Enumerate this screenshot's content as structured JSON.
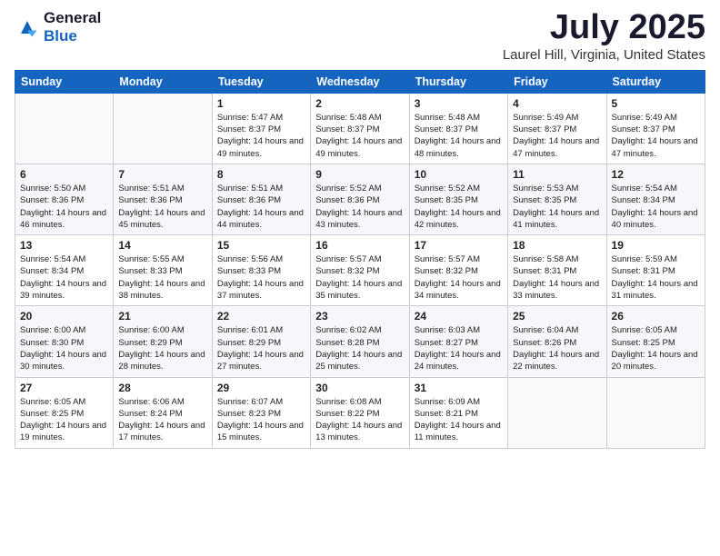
{
  "header": {
    "logo_general": "General",
    "logo_blue": "Blue",
    "month": "July 2025",
    "location": "Laurel Hill, Virginia, United States"
  },
  "days_of_week": [
    "Sunday",
    "Monday",
    "Tuesday",
    "Wednesday",
    "Thursday",
    "Friday",
    "Saturday"
  ],
  "weeks": [
    [
      {
        "day": "",
        "sunrise": "",
        "sunset": "",
        "daylight": ""
      },
      {
        "day": "",
        "sunrise": "",
        "sunset": "",
        "daylight": ""
      },
      {
        "day": "1",
        "sunrise": "Sunrise: 5:47 AM",
        "sunset": "Sunset: 8:37 PM",
        "daylight": "Daylight: 14 hours and 49 minutes."
      },
      {
        "day": "2",
        "sunrise": "Sunrise: 5:48 AM",
        "sunset": "Sunset: 8:37 PM",
        "daylight": "Daylight: 14 hours and 49 minutes."
      },
      {
        "day": "3",
        "sunrise": "Sunrise: 5:48 AM",
        "sunset": "Sunset: 8:37 PM",
        "daylight": "Daylight: 14 hours and 48 minutes."
      },
      {
        "day": "4",
        "sunrise": "Sunrise: 5:49 AM",
        "sunset": "Sunset: 8:37 PM",
        "daylight": "Daylight: 14 hours and 47 minutes."
      },
      {
        "day": "5",
        "sunrise": "Sunrise: 5:49 AM",
        "sunset": "Sunset: 8:37 PM",
        "daylight": "Daylight: 14 hours and 47 minutes."
      }
    ],
    [
      {
        "day": "6",
        "sunrise": "Sunrise: 5:50 AM",
        "sunset": "Sunset: 8:36 PM",
        "daylight": "Daylight: 14 hours and 46 minutes."
      },
      {
        "day": "7",
        "sunrise": "Sunrise: 5:51 AM",
        "sunset": "Sunset: 8:36 PM",
        "daylight": "Daylight: 14 hours and 45 minutes."
      },
      {
        "day": "8",
        "sunrise": "Sunrise: 5:51 AM",
        "sunset": "Sunset: 8:36 PM",
        "daylight": "Daylight: 14 hours and 44 minutes."
      },
      {
        "day": "9",
        "sunrise": "Sunrise: 5:52 AM",
        "sunset": "Sunset: 8:36 PM",
        "daylight": "Daylight: 14 hours and 43 minutes."
      },
      {
        "day": "10",
        "sunrise": "Sunrise: 5:52 AM",
        "sunset": "Sunset: 8:35 PM",
        "daylight": "Daylight: 14 hours and 42 minutes."
      },
      {
        "day": "11",
        "sunrise": "Sunrise: 5:53 AM",
        "sunset": "Sunset: 8:35 PM",
        "daylight": "Daylight: 14 hours and 41 minutes."
      },
      {
        "day": "12",
        "sunrise": "Sunrise: 5:54 AM",
        "sunset": "Sunset: 8:34 PM",
        "daylight": "Daylight: 14 hours and 40 minutes."
      }
    ],
    [
      {
        "day": "13",
        "sunrise": "Sunrise: 5:54 AM",
        "sunset": "Sunset: 8:34 PM",
        "daylight": "Daylight: 14 hours and 39 minutes."
      },
      {
        "day": "14",
        "sunrise": "Sunrise: 5:55 AM",
        "sunset": "Sunset: 8:33 PM",
        "daylight": "Daylight: 14 hours and 38 minutes."
      },
      {
        "day": "15",
        "sunrise": "Sunrise: 5:56 AM",
        "sunset": "Sunset: 8:33 PM",
        "daylight": "Daylight: 14 hours and 37 minutes."
      },
      {
        "day": "16",
        "sunrise": "Sunrise: 5:57 AM",
        "sunset": "Sunset: 8:32 PM",
        "daylight": "Daylight: 14 hours and 35 minutes."
      },
      {
        "day": "17",
        "sunrise": "Sunrise: 5:57 AM",
        "sunset": "Sunset: 8:32 PM",
        "daylight": "Daylight: 14 hours and 34 minutes."
      },
      {
        "day": "18",
        "sunrise": "Sunrise: 5:58 AM",
        "sunset": "Sunset: 8:31 PM",
        "daylight": "Daylight: 14 hours and 33 minutes."
      },
      {
        "day": "19",
        "sunrise": "Sunrise: 5:59 AM",
        "sunset": "Sunset: 8:31 PM",
        "daylight": "Daylight: 14 hours and 31 minutes."
      }
    ],
    [
      {
        "day": "20",
        "sunrise": "Sunrise: 6:00 AM",
        "sunset": "Sunset: 8:30 PM",
        "daylight": "Daylight: 14 hours and 30 minutes."
      },
      {
        "day": "21",
        "sunrise": "Sunrise: 6:00 AM",
        "sunset": "Sunset: 8:29 PM",
        "daylight": "Daylight: 14 hours and 28 minutes."
      },
      {
        "day": "22",
        "sunrise": "Sunrise: 6:01 AM",
        "sunset": "Sunset: 8:29 PM",
        "daylight": "Daylight: 14 hours and 27 minutes."
      },
      {
        "day": "23",
        "sunrise": "Sunrise: 6:02 AM",
        "sunset": "Sunset: 8:28 PM",
        "daylight": "Daylight: 14 hours and 25 minutes."
      },
      {
        "day": "24",
        "sunrise": "Sunrise: 6:03 AM",
        "sunset": "Sunset: 8:27 PM",
        "daylight": "Daylight: 14 hours and 24 minutes."
      },
      {
        "day": "25",
        "sunrise": "Sunrise: 6:04 AM",
        "sunset": "Sunset: 8:26 PM",
        "daylight": "Daylight: 14 hours and 22 minutes."
      },
      {
        "day": "26",
        "sunrise": "Sunrise: 6:05 AM",
        "sunset": "Sunset: 8:25 PM",
        "daylight": "Daylight: 14 hours and 20 minutes."
      }
    ],
    [
      {
        "day": "27",
        "sunrise": "Sunrise: 6:05 AM",
        "sunset": "Sunset: 8:25 PM",
        "daylight": "Daylight: 14 hours and 19 minutes."
      },
      {
        "day": "28",
        "sunrise": "Sunrise: 6:06 AM",
        "sunset": "Sunset: 8:24 PM",
        "daylight": "Daylight: 14 hours and 17 minutes."
      },
      {
        "day": "29",
        "sunrise": "Sunrise: 6:07 AM",
        "sunset": "Sunset: 8:23 PM",
        "daylight": "Daylight: 14 hours and 15 minutes."
      },
      {
        "day": "30",
        "sunrise": "Sunrise: 6:08 AM",
        "sunset": "Sunset: 8:22 PM",
        "daylight": "Daylight: 14 hours and 13 minutes."
      },
      {
        "day": "31",
        "sunrise": "Sunrise: 6:09 AM",
        "sunset": "Sunset: 8:21 PM",
        "daylight": "Daylight: 14 hours and 11 minutes."
      },
      {
        "day": "",
        "sunrise": "",
        "sunset": "",
        "daylight": ""
      },
      {
        "day": "",
        "sunrise": "",
        "sunset": "",
        "daylight": ""
      }
    ]
  ]
}
